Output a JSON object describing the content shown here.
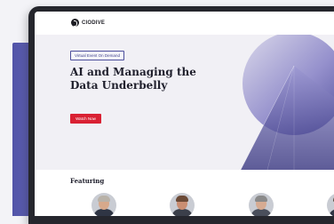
{
  "site": {
    "logo_text": "CIODIVE",
    "logo_icon": "ciodive-logo-icon"
  },
  "hero": {
    "tag": "Virtual Event On Demand",
    "title": "AI and Managing the Data Underbelly",
    "cta_label": "Watch Now"
  },
  "featuring": {
    "heading": "Featuring",
    "speakers_visible": 4
  },
  "colors": {
    "accent_purple": "#4c4e9c",
    "cta_red": "#d92133",
    "device_frame": "#25262d"
  }
}
